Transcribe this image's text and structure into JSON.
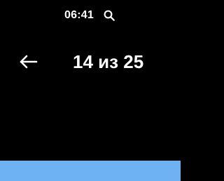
{
  "status_bar": {
    "time": "06:41",
    "search_icon": "search-icon"
  },
  "header": {
    "back_icon": "arrow-left-icon",
    "title": "14 из 25"
  },
  "colors": {
    "background": "#000000",
    "text": "#ffffff",
    "bottom_bar": "#6fb2f3"
  }
}
